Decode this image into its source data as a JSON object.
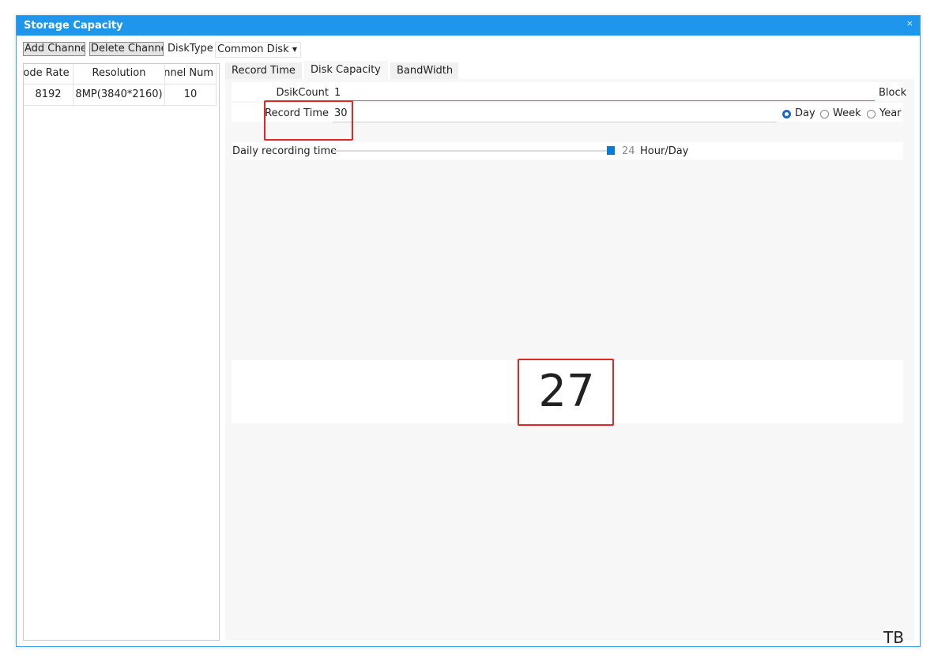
{
  "window": {
    "title": "Storage Capacity",
    "close_glyph": "×"
  },
  "toolbar": {
    "add_channel_label": "Add Channel",
    "delete_channel_label": "Delete Channel",
    "disk_type_label": "DiskType",
    "disk_type_value": "Common Disk"
  },
  "grid": {
    "headers": [
      "Code Rate",
      "Resolution",
      "Channel Num"
    ],
    "rows": [
      [
        "8192",
        "8MP(3840*2160)",
        "10"
      ]
    ]
  },
  "tabs": [
    {
      "label": "Record Time",
      "active": false
    },
    {
      "label": "Disk Capacity",
      "active": true
    },
    {
      "label": "BandWidth",
      "active": false
    }
  ],
  "form": {
    "disk_count_label": "DsikCount",
    "disk_count_value": "1",
    "disk_count_unit": "Block",
    "record_time_label": "Record Time",
    "record_time_value": "30",
    "period_options": [
      {
        "label": "Day",
        "checked": true
      },
      {
        "label": "Week",
        "checked": false
      },
      {
        "label": "Year",
        "checked": false
      }
    ],
    "daily_label": "Daily recording time",
    "daily_value": "24",
    "daily_unit": "Hour/Day",
    "daily_fraction": 1.0
  },
  "result": {
    "value": "27",
    "unit": "TB"
  },
  "colors": {
    "titlebar": "#1e96ec",
    "accent": "#0c7bd8",
    "highlight": "#e12626"
  }
}
